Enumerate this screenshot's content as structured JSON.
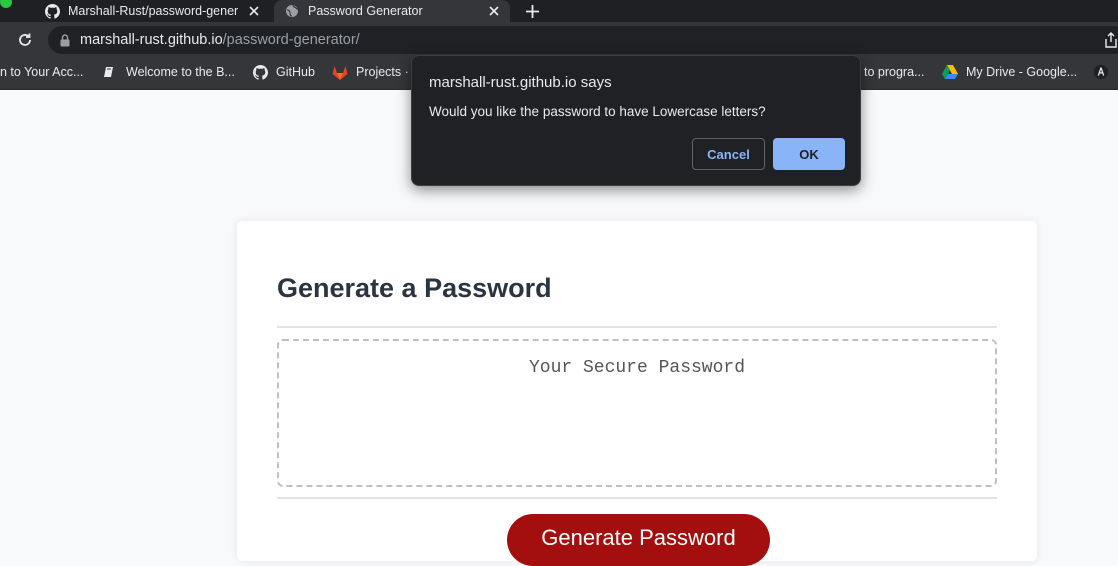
{
  "browser": {
    "tabs": [
      {
        "title": "Marshall-Rust/password-gener",
        "icon": "github-icon"
      },
      {
        "title": "Password Generator",
        "icon": "globe-icon"
      }
    ],
    "url_host": "marshall-rust.github.io",
    "url_path": "/password-generator/",
    "bookmarks": [
      {
        "label": "n to Your Acc...",
        "icon": "page-icon"
      },
      {
        "label": "Welcome to the B...",
        "icon": "book-icon"
      },
      {
        "label": "GitHub",
        "icon": "github-icon"
      },
      {
        "label": "Projects ·",
        "icon": "gitlab-icon"
      },
      {
        "label": "to progra...",
        "icon": "page-icon"
      },
      {
        "label": "My Drive - Google...",
        "icon": "google-drive-icon"
      }
    ]
  },
  "page": {
    "header": "Generate a Password",
    "password_placeholder": "Your Secure Password",
    "generate_button": "Generate Password"
  },
  "dialog": {
    "title": "marshall-rust.github.io says",
    "message": "Would you like the password to have Lowercase letters?",
    "cancel_label": "Cancel",
    "ok_label": "OK"
  },
  "colors": {
    "accent_button": "#a30f0f",
    "dialog_ok": "#8ab4f8",
    "header_text": "#2b3440"
  }
}
